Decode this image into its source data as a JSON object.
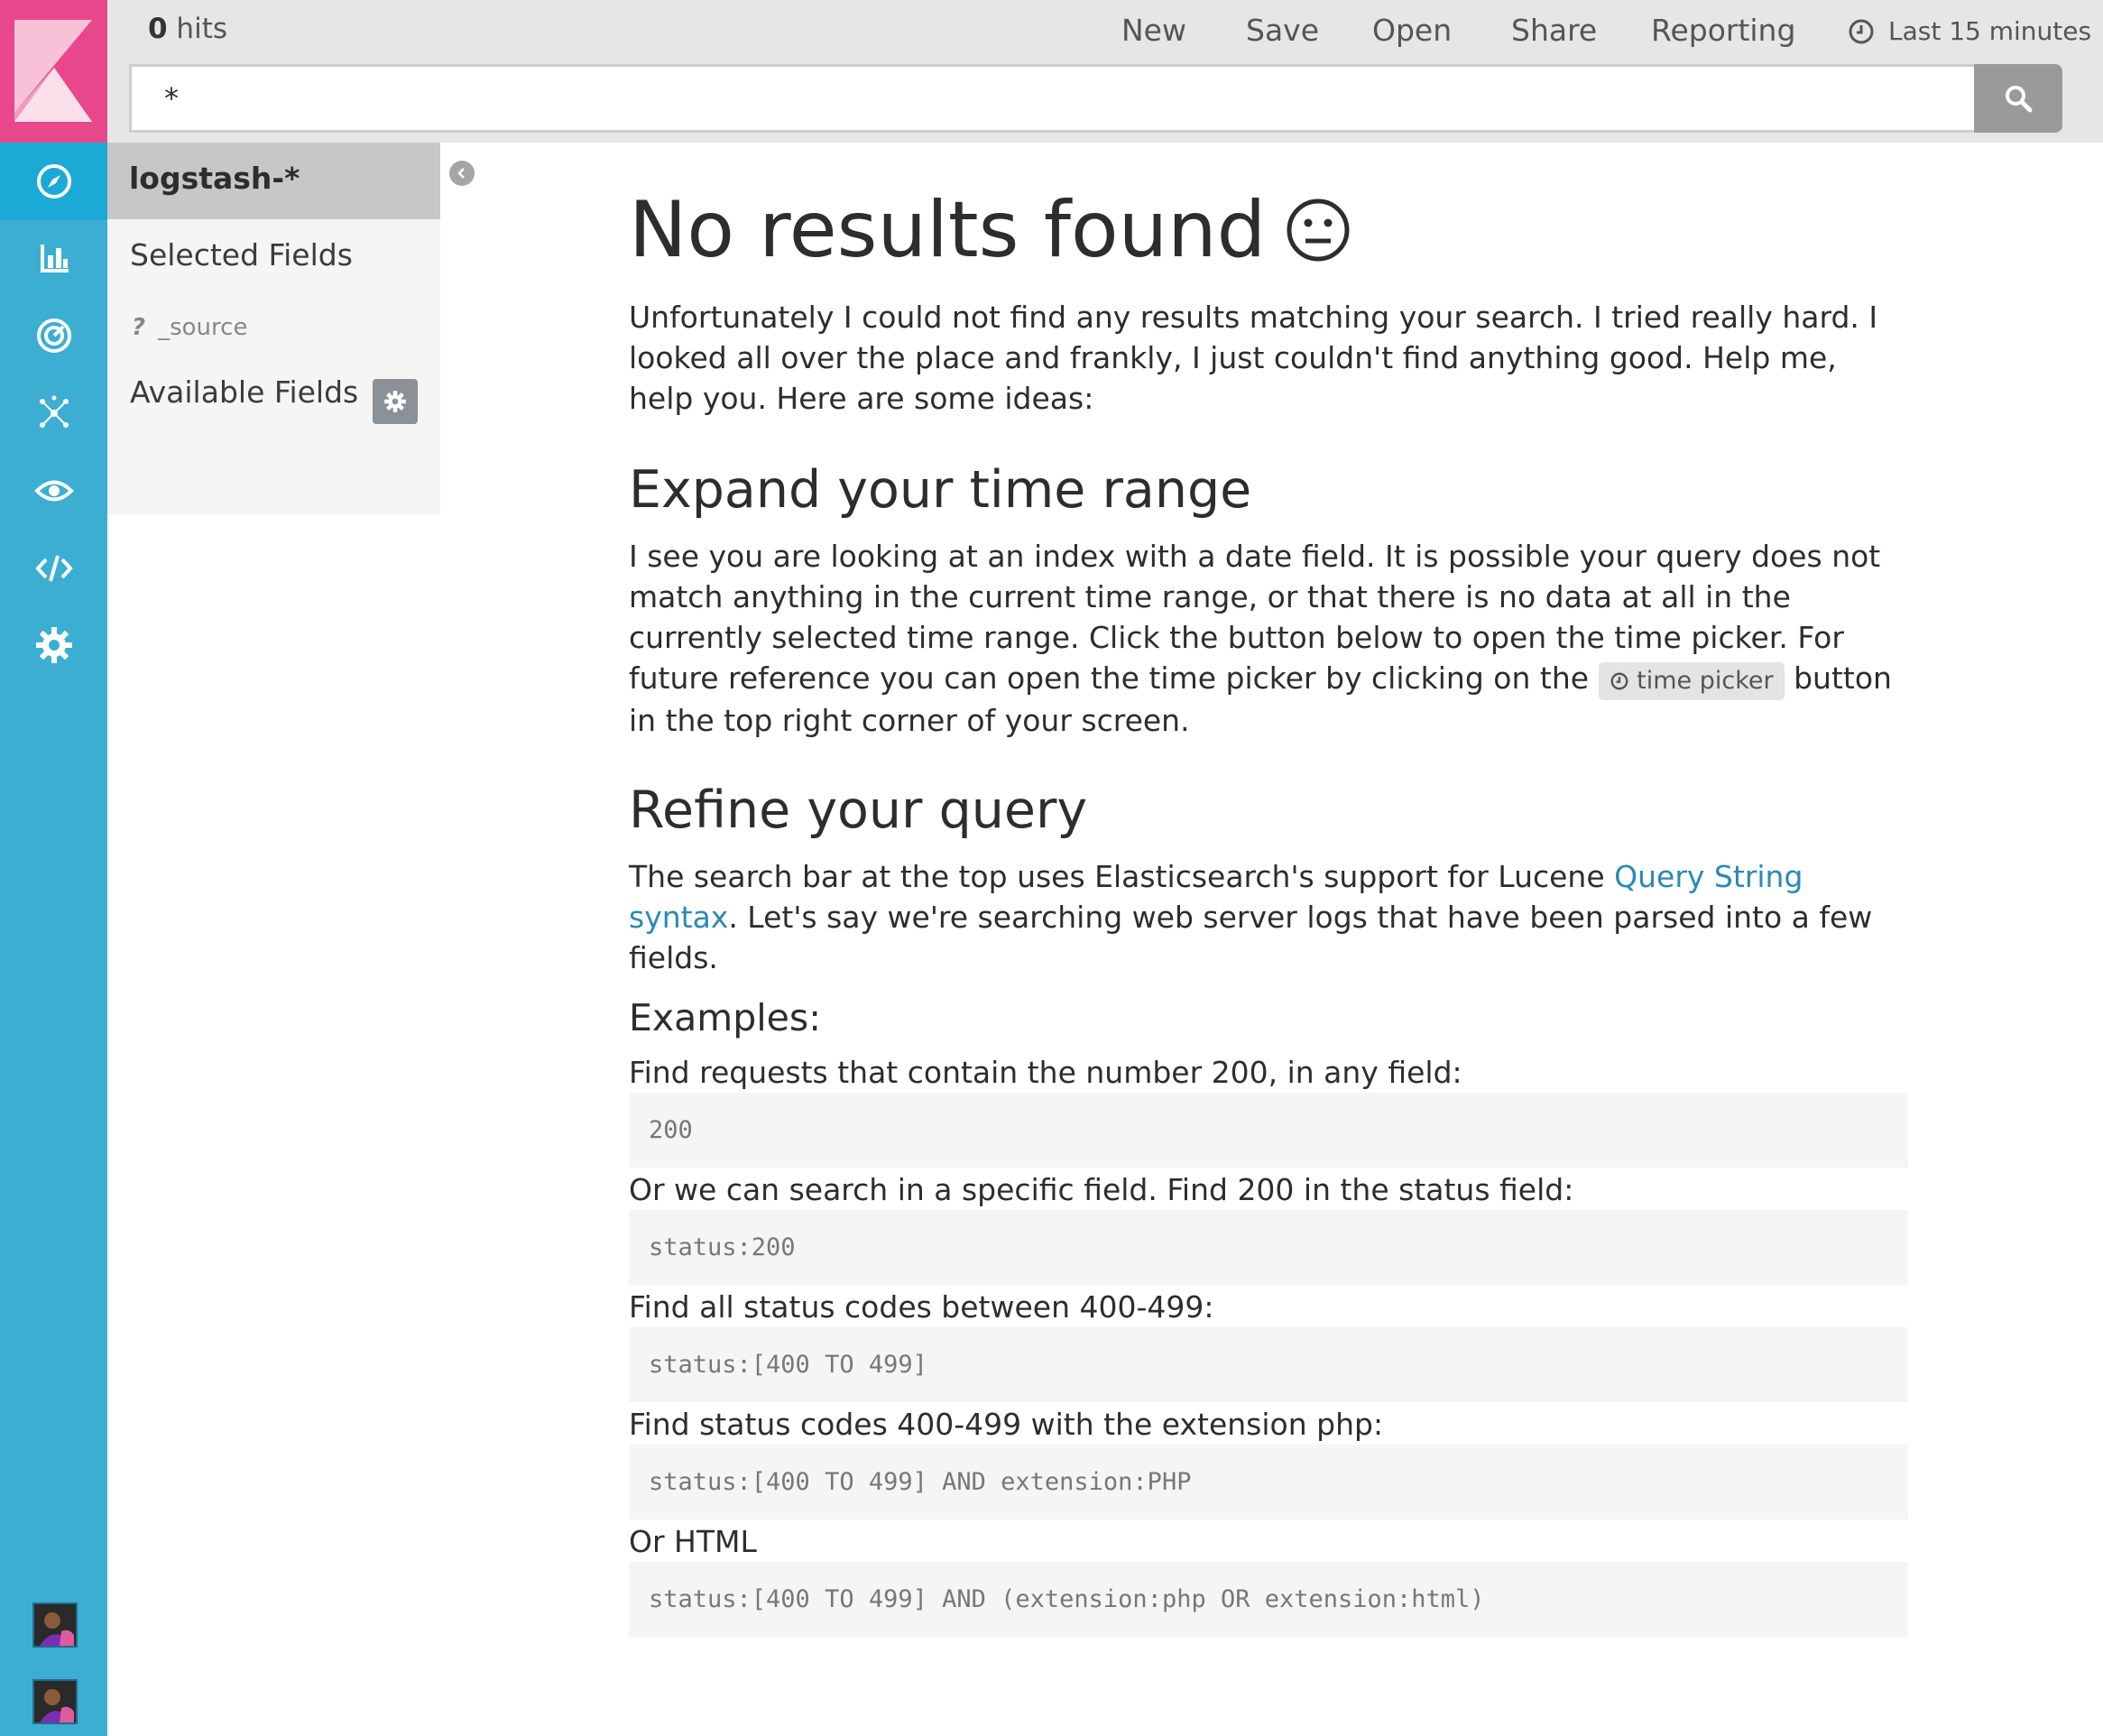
{
  "topbar": {
    "hits_count": "0",
    "hits_label": " hits",
    "menu": [
      "New",
      "Save",
      "Open",
      "Share",
      "Reporting"
    ],
    "time_range": "Last 15 minutes",
    "query": "*"
  },
  "sidebar": {
    "index_pattern": "logstash-*",
    "selected_fields_label": "Selected Fields",
    "source_field_type": "?",
    "source_field": "_source",
    "available_fields_label": "Available Fields"
  },
  "main": {
    "title": "No results found",
    "intro": "Unfortunately I could not find any results matching your search. I tried really hard. I looked all over the place and frankly, I just couldn't find anything good. Help me, help you. Here are some ideas:",
    "time_heading": "Expand your time range",
    "time_text_before": "I see you are looking at an index with a date field. It is possible your query does not match anything in the current time range, or that there is no data at all in the currently selected time range. Click the button below to open the time picker. For future reference you can open the time picker by clicking on the",
    "time_picker_label": "time picker",
    "time_text_after": "button in the top right corner of your screen.",
    "query_heading": "Refine your query",
    "query_text_before": "The search bar at the top uses Elasticsearch's support for Lucene",
    "query_link": "Query String syntax",
    "query_text_after": ". Let's say we're searching web server logs that have been parsed into a few fields.",
    "examples_heading": "Examples:",
    "examples": [
      {
        "text": "Find requests that contain the number 200, in any field:",
        "code": "200"
      },
      {
        "text": "Or we can search in a specific field. Find 200 in the status field:",
        "code": "status:200"
      },
      {
        "text": "Find all status codes between 400-499:",
        "code": "status:[400 TO 499]"
      },
      {
        "text": "Find status codes 400-499 with the extension php:",
        "code": "status:[400 TO 499] AND extension:PHP"
      },
      {
        "text": "Or HTML",
        "code": "status:[400 TO 499] AND (extension:php OR extension:html)"
      }
    ]
  },
  "colors": {
    "nav": "#3caed2",
    "logo": "#e8488b",
    "link": "#2a8ab3"
  },
  "icons": {
    "nav": [
      "discover-icon",
      "visualize-icon",
      "dashboard-icon",
      "timelion-icon",
      "monitoring-icon",
      "dev-tools-icon",
      "management-icon"
    ]
  }
}
